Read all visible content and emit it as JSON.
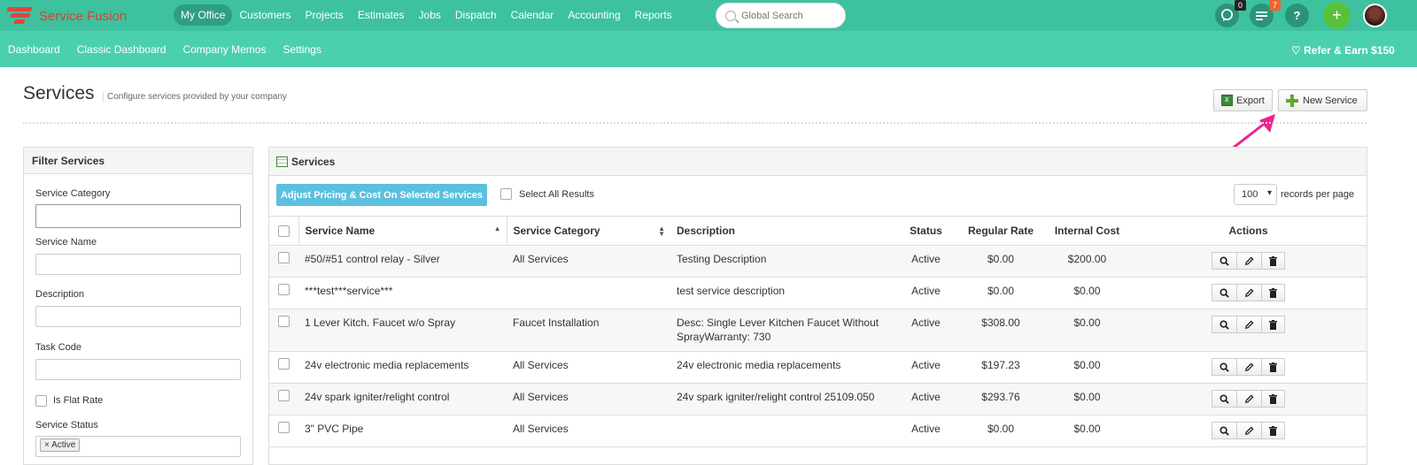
{
  "app": {
    "brand": "Service Fusion"
  },
  "topnav": {
    "items": [
      "My Office",
      "Customers",
      "Projects",
      "Estimates",
      "Jobs",
      "Dispatch",
      "Calendar",
      "Accounting",
      "Reports"
    ],
    "active_index": 0,
    "search_placeholder": "Global Search",
    "chat_badge": "0",
    "notif_badge": "7",
    "help_label": "?",
    "plus_label": "+"
  },
  "subnav": {
    "items": [
      "Dashboard",
      "Classic Dashboard",
      "Company Memos",
      "Settings"
    ],
    "refer": "Refer & Earn $150"
  },
  "page": {
    "title": "Services",
    "subtitle": "Configure services provided by your company",
    "export_label": "Export",
    "new_label": "New Service"
  },
  "filter": {
    "title": "Filter Services",
    "service_category": "Service Category",
    "service_name": "Service Name",
    "description": "Description",
    "task_code": "Task Code",
    "flat_rate": "Is Flat Rate",
    "service_status": "Service Status",
    "status_tag": "× Active"
  },
  "services": {
    "title": "Services",
    "adjust_label": "Adjust Pricing & Cost On Selected Services",
    "select_all": "Select All Results",
    "rpp_value": "100",
    "rpp_label": "records per page",
    "columns": [
      "Service Name",
      "Service Category",
      "Description",
      "Status",
      "Regular Rate",
      "Internal Cost",
      "Actions"
    ],
    "rows": [
      {
        "name": "#50/#51 control relay - Silver",
        "category": "All Services",
        "desc": "Testing Description",
        "status": "Active",
        "rate": "$0.00",
        "cost": "$200.00"
      },
      {
        "name": "***test***service***",
        "category": "",
        "desc": "test service description",
        "status": "Active",
        "rate": "$0.00",
        "cost": "$0.00"
      },
      {
        "name": "1 Lever Kitch. Faucet w/o Spray",
        "category": "Faucet Installation",
        "desc": "Desc: Single Lever Kitchen Faucet Without SprayWarranty: 730",
        "status": "Active",
        "rate": "$308.00",
        "cost": "$0.00"
      },
      {
        "name": "24v electronic media replacements",
        "category": "All Services",
        "desc": "24v electronic media replacements",
        "status": "Active",
        "rate": "$197.23",
        "cost": "$0.00"
      },
      {
        "name": "24v spark igniter/relight control",
        "category": "All Services",
        "desc": "24v spark igniter/relight control 25109.050",
        "status": "Active",
        "rate": "$293.76",
        "cost": "$0.00"
      },
      {
        "name": "3\" PVC Pipe",
        "category": "All Services",
        "desc": "",
        "status": "Active",
        "rate": "$0.00",
        "cost": "$0.00"
      }
    ]
  }
}
